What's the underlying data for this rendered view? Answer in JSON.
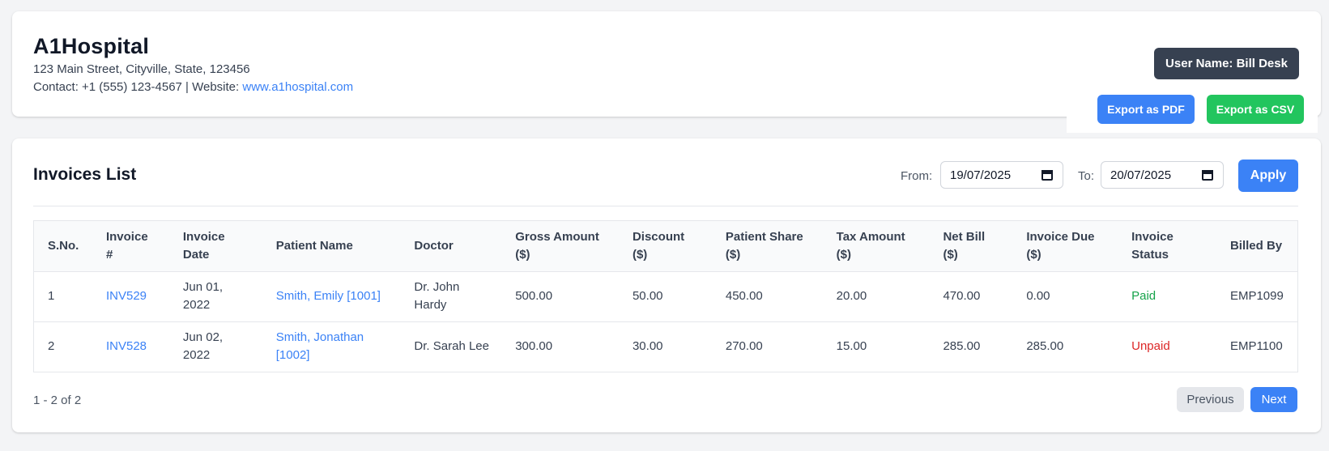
{
  "header": {
    "hospital_name": "A1Hospital",
    "address": "123 Main Street, Cityville, State, 123456",
    "contact_prefix": "Contact: +1 (555) 123-4567 | Website: ",
    "website": "www.a1hospital.com",
    "user_badge": "User Name: Bill Desk",
    "export_pdf": "Export as PDF",
    "export_csv": "Export as CSV"
  },
  "invoices": {
    "title": "Invoices List",
    "from_label": "From:",
    "from_value": "19/07/2025",
    "to_label": "To:",
    "to_value": "20/07/2025",
    "apply_label": "Apply",
    "columns": [
      [
        "S.No."
      ],
      [
        "Invoice",
        "#"
      ],
      [
        "Invoice",
        "Date"
      ],
      [
        "Patient Name"
      ],
      [
        "Doctor"
      ],
      [
        "Gross Amount",
        "($)"
      ],
      [
        "Discount",
        "($)"
      ],
      [
        "Patient Share",
        "($)"
      ],
      [
        "Tax Amount",
        "($)"
      ],
      [
        "Net Bill",
        "($)"
      ],
      [
        "Invoice Due",
        "($)"
      ],
      [
        "Invoice",
        "Status"
      ],
      [
        "Billed By"
      ]
    ],
    "rows": [
      {
        "sno": "1",
        "invoice": "INV529",
        "date": [
          "Jun 01,",
          "2022"
        ],
        "patient": [
          "Smith, Emily [1001]"
        ],
        "doctor": [
          "Dr. John",
          "Hardy"
        ],
        "gross": "500.00",
        "discount": "50.00",
        "patient_share": "450.00",
        "tax": "20.00",
        "net": "470.00",
        "due": "0.00",
        "status": "Paid",
        "billed_by": "EMP1099"
      },
      {
        "sno": "2",
        "invoice": "INV528",
        "date": [
          "Jun 02,",
          "2022"
        ],
        "patient": [
          "Smith, Jonathan",
          "[1002]"
        ],
        "doctor": [
          "Dr. Sarah Lee"
        ],
        "gross": "300.00",
        "discount": "30.00",
        "patient_share": "270.00",
        "tax": "15.00",
        "net": "285.00",
        "due": "285.00",
        "status": "Unpaid",
        "billed_by": "EMP1100"
      }
    ],
    "pager_info": "1 - 2 of 2",
    "prev_label": "Previous",
    "next_label": "Next"
  },
  "colors": {
    "primary": "#3b82f6",
    "success": "#22c55e",
    "dark": "#374151",
    "paid": "#16a34a",
    "unpaid": "#dc2626"
  },
  "icons": {
    "date_picker": "calendar-icon"
  }
}
